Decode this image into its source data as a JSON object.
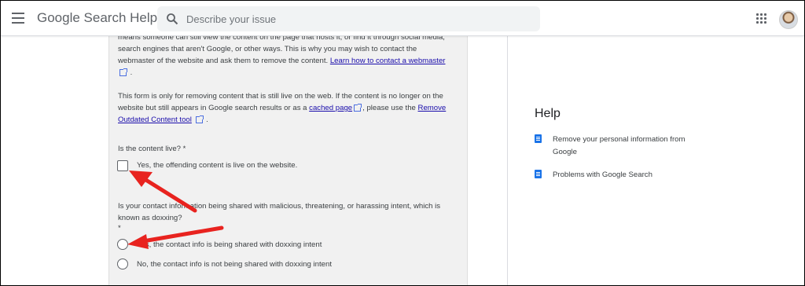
{
  "header": {
    "menu_icon": "hamburger-menu-icon",
    "title": "Google Search Help",
    "search_placeholder": "Describe your issue",
    "search_icon": "search-icon",
    "apps_icon": "apps-grid-icon"
  },
  "form": {
    "para1": {
      "line1": "means someone can still view the content on the page that hosts it, or find it through social media,",
      "line2": "search engines that aren't Google, or other ways. This is why you may wish to contact the",
      "line3_text": "webmaster of the website and ask them to remove the content. ",
      "line3_link": "Learn how to contact a webmaster",
      "line4_suffix": "."
    },
    "para2": {
      "line1": "This form is only for removing content that is still live on the web. If the content is no longer on the",
      "line2_text": "website but still appears in Google search results or as a ",
      "line2_link": "cached page",
      "line2_text2": ", please use the ",
      "line2_link2": "Remove",
      "line3_link": "Outdated Content tool",
      "line3_suffix": "."
    },
    "q1": {
      "label": "Is the content live? *",
      "option": "Yes, the offending content is live on the website."
    },
    "q2": {
      "line1": "Is your contact information being shared with malicious, threatening, or harassing intent, which is",
      "line2": "known as doxxing?",
      "required": "*",
      "option_yes": "Yes, the contact info is being shared with doxxing intent",
      "option_no": "No, the contact info is not being shared with doxxing intent"
    }
  },
  "help": {
    "title": "Help",
    "items": [
      {
        "line1": "Remove your personal information from",
        "line2": "Google"
      },
      {
        "line1": "Problems with Google Search"
      }
    ]
  },
  "colors": {
    "annotation_arrow": "#e8231f",
    "link": "#1a0dab",
    "help_icon": "#1a73e8"
  }
}
